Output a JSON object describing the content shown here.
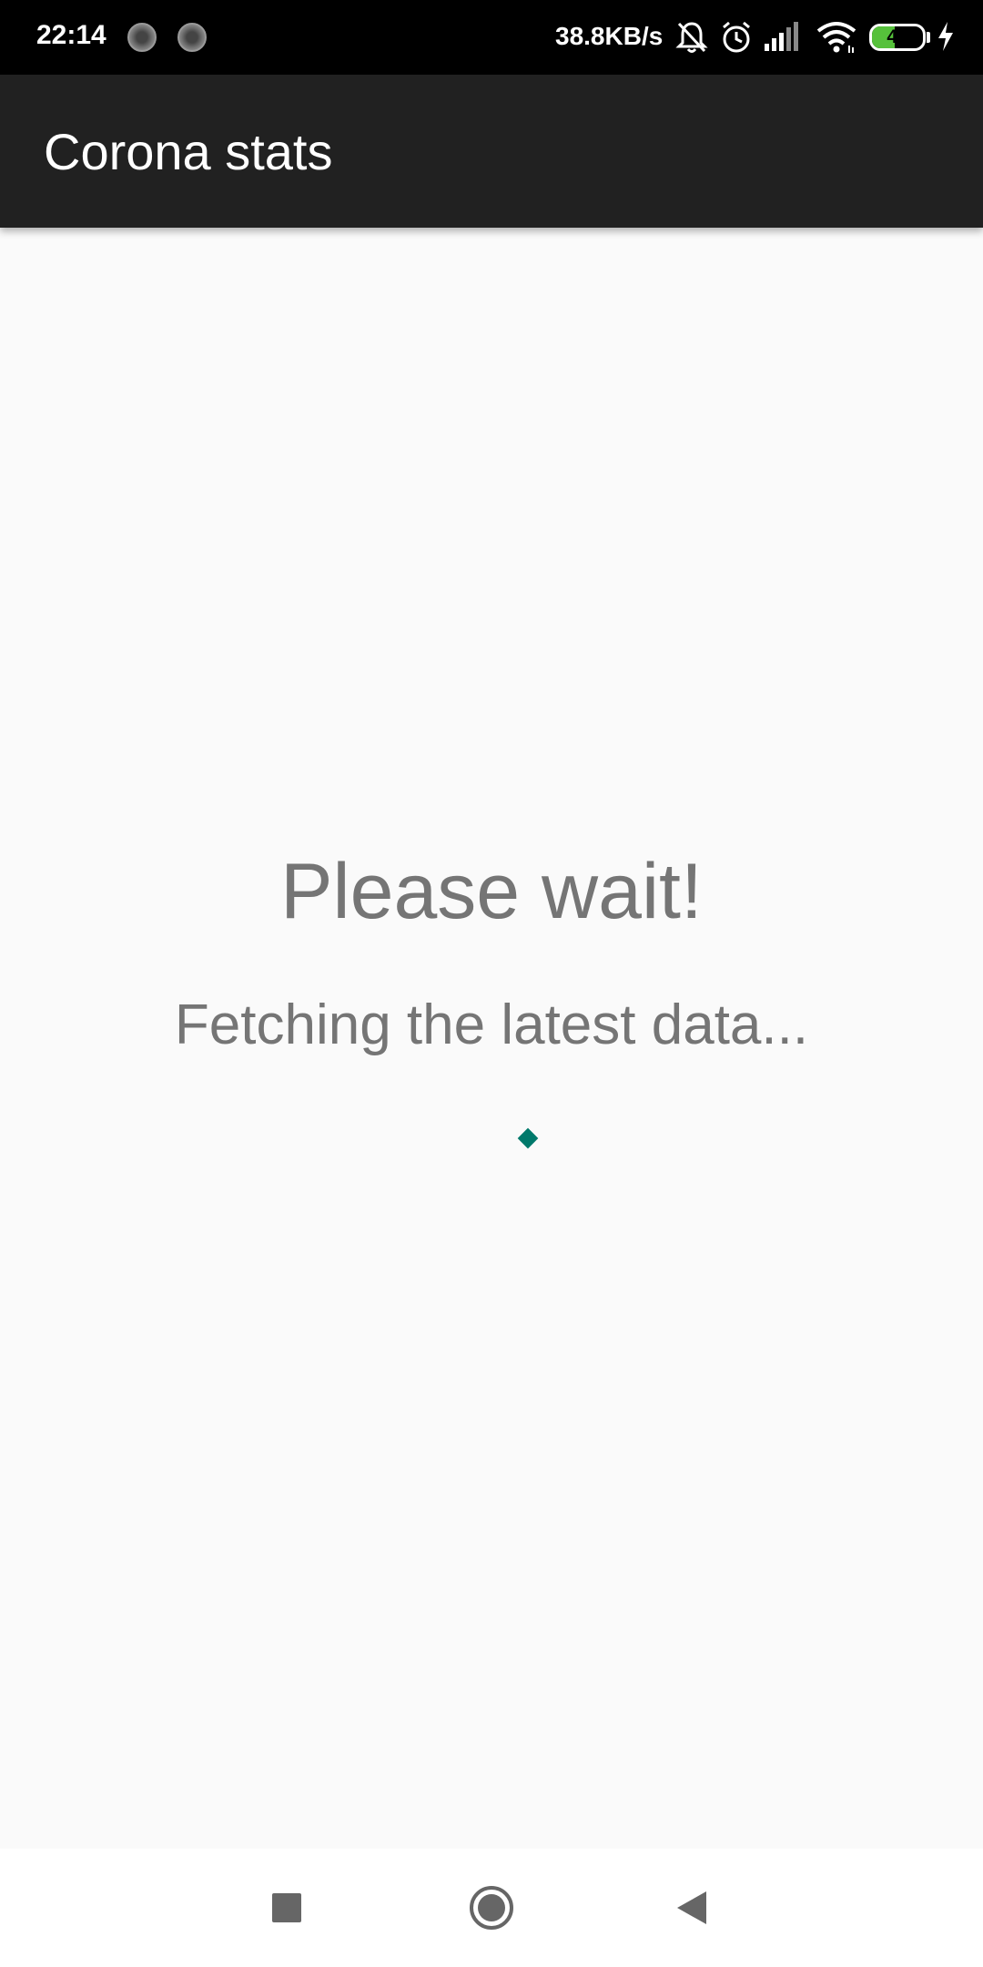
{
  "status_bar": {
    "time": "22:14",
    "network_speed": "38.8KB/s",
    "battery_level": "45",
    "battery_fraction": 0.45,
    "icons": [
      "notification-dot-icon",
      "notification-dot-icon",
      "bell-off-icon",
      "alarm-icon",
      "signal-icon",
      "wifi-icon",
      "battery-icon",
      "charging-icon"
    ]
  },
  "app_bar": {
    "title": "Corona stats"
  },
  "loading": {
    "title": "Please wait!",
    "message": "Fetching the latest data..."
  },
  "nav_bar": {
    "icons": [
      "recents-icon",
      "home-icon",
      "back-icon"
    ]
  },
  "colors": {
    "app_bar": "#212121",
    "accent": "#00796b",
    "text_secondary": "#757575",
    "background": "#fafafa"
  }
}
